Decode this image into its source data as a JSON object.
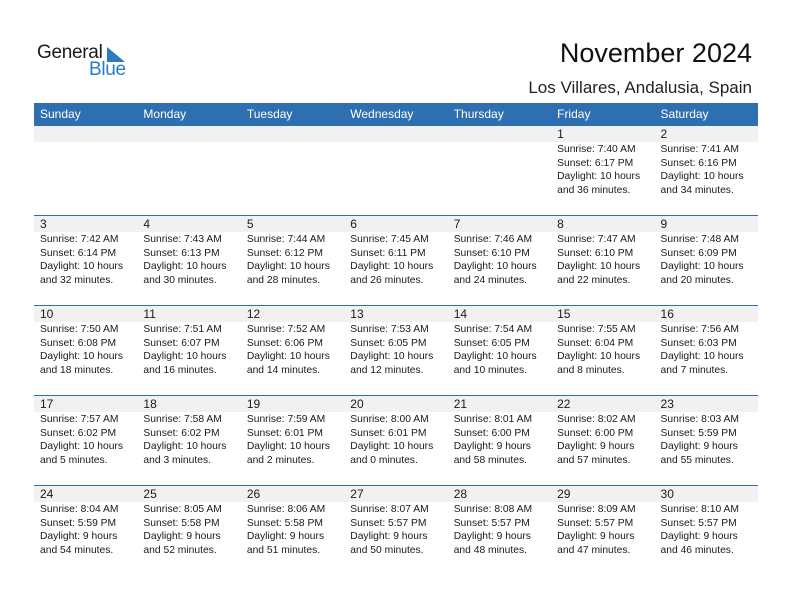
{
  "logo": {
    "general": "General",
    "blue": "Blue"
  },
  "title": "November 2024",
  "subtitle": "Los Villares, Andalusia, Spain",
  "colors": {
    "header_bg": "#2e6fb1",
    "daynum_bg": "#f1f1f1",
    "logo_blue": "#2a7bc4"
  },
  "weekdays": [
    "Sunday",
    "Monday",
    "Tuesday",
    "Wednesday",
    "Thursday",
    "Friday",
    "Saturday"
  ],
  "weeks": [
    [
      null,
      null,
      null,
      null,
      null,
      {
        "day": "1",
        "sunrise": "Sunrise: 7:40 AM",
        "sunset": "Sunset: 6:17 PM",
        "daylight1": "Daylight: 10 hours",
        "daylight2": "and 36 minutes."
      },
      {
        "day": "2",
        "sunrise": "Sunrise: 7:41 AM",
        "sunset": "Sunset: 6:16 PM",
        "daylight1": "Daylight: 10 hours",
        "daylight2": "and 34 minutes."
      }
    ],
    [
      {
        "day": "3",
        "sunrise": "Sunrise: 7:42 AM",
        "sunset": "Sunset: 6:14 PM",
        "daylight1": "Daylight: 10 hours",
        "daylight2": "and 32 minutes."
      },
      {
        "day": "4",
        "sunrise": "Sunrise: 7:43 AM",
        "sunset": "Sunset: 6:13 PM",
        "daylight1": "Daylight: 10 hours",
        "daylight2": "and 30 minutes."
      },
      {
        "day": "5",
        "sunrise": "Sunrise: 7:44 AM",
        "sunset": "Sunset: 6:12 PM",
        "daylight1": "Daylight: 10 hours",
        "daylight2": "and 28 minutes."
      },
      {
        "day": "6",
        "sunrise": "Sunrise: 7:45 AM",
        "sunset": "Sunset: 6:11 PM",
        "daylight1": "Daylight: 10 hours",
        "daylight2": "and 26 minutes."
      },
      {
        "day": "7",
        "sunrise": "Sunrise: 7:46 AM",
        "sunset": "Sunset: 6:10 PM",
        "daylight1": "Daylight: 10 hours",
        "daylight2": "and 24 minutes."
      },
      {
        "day": "8",
        "sunrise": "Sunrise: 7:47 AM",
        "sunset": "Sunset: 6:10 PM",
        "daylight1": "Daylight: 10 hours",
        "daylight2": "and 22 minutes."
      },
      {
        "day": "9",
        "sunrise": "Sunrise: 7:48 AM",
        "sunset": "Sunset: 6:09 PM",
        "daylight1": "Daylight: 10 hours",
        "daylight2": "and 20 minutes."
      }
    ],
    [
      {
        "day": "10",
        "sunrise": "Sunrise: 7:50 AM",
        "sunset": "Sunset: 6:08 PM",
        "daylight1": "Daylight: 10 hours",
        "daylight2": "and 18 minutes."
      },
      {
        "day": "11",
        "sunrise": "Sunrise: 7:51 AM",
        "sunset": "Sunset: 6:07 PM",
        "daylight1": "Daylight: 10 hours",
        "daylight2": "and 16 minutes."
      },
      {
        "day": "12",
        "sunrise": "Sunrise: 7:52 AM",
        "sunset": "Sunset: 6:06 PM",
        "daylight1": "Daylight: 10 hours",
        "daylight2": "and 14 minutes."
      },
      {
        "day": "13",
        "sunrise": "Sunrise: 7:53 AM",
        "sunset": "Sunset: 6:05 PM",
        "daylight1": "Daylight: 10 hours",
        "daylight2": "and 12 minutes."
      },
      {
        "day": "14",
        "sunrise": "Sunrise: 7:54 AM",
        "sunset": "Sunset: 6:05 PM",
        "daylight1": "Daylight: 10 hours",
        "daylight2": "and 10 minutes."
      },
      {
        "day": "15",
        "sunrise": "Sunrise: 7:55 AM",
        "sunset": "Sunset: 6:04 PM",
        "daylight1": "Daylight: 10 hours",
        "daylight2": "and 8 minutes."
      },
      {
        "day": "16",
        "sunrise": "Sunrise: 7:56 AM",
        "sunset": "Sunset: 6:03 PM",
        "daylight1": "Daylight: 10 hours",
        "daylight2": "and 7 minutes."
      }
    ],
    [
      {
        "day": "17",
        "sunrise": "Sunrise: 7:57 AM",
        "sunset": "Sunset: 6:02 PM",
        "daylight1": "Daylight: 10 hours",
        "daylight2": "and 5 minutes."
      },
      {
        "day": "18",
        "sunrise": "Sunrise: 7:58 AM",
        "sunset": "Sunset: 6:02 PM",
        "daylight1": "Daylight: 10 hours",
        "daylight2": "and 3 minutes."
      },
      {
        "day": "19",
        "sunrise": "Sunrise: 7:59 AM",
        "sunset": "Sunset: 6:01 PM",
        "daylight1": "Daylight: 10 hours",
        "daylight2": "and 2 minutes."
      },
      {
        "day": "20",
        "sunrise": "Sunrise: 8:00 AM",
        "sunset": "Sunset: 6:01 PM",
        "daylight1": "Daylight: 10 hours",
        "daylight2": "and 0 minutes."
      },
      {
        "day": "21",
        "sunrise": "Sunrise: 8:01 AM",
        "sunset": "Sunset: 6:00 PM",
        "daylight1": "Daylight: 9 hours",
        "daylight2": "and 58 minutes."
      },
      {
        "day": "22",
        "sunrise": "Sunrise: 8:02 AM",
        "sunset": "Sunset: 6:00 PM",
        "daylight1": "Daylight: 9 hours",
        "daylight2": "and 57 minutes."
      },
      {
        "day": "23",
        "sunrise": "Sunrise: 8:03 AM",
        "sunset": "Sunset: 5:59 PM",
        "daylight1": "Daylight: 9 hours",
        "daylight2": "and 55 minutes."
      }
    ],
    [
      {
        "day": "24",
        "sunrise": "Sunrise: 8:04 AM",
        "sunset": "Sunset: 5:59 PM",
        "daylight1": "Daylight: 9 hours",
        "daylight2": "and 54 minutes."
      },
      {
        "day": "25",
        "sunrise": "Sunrise: 8:05 AM",
        "sunset": "Sunset: 5:58 PM",
        "daylight1": "Daylight: 9 hours",
        "daylight2": "and 52 minutes."
      },
      {
        "day": "26",
        "sunrise": "Sunrise: 8:06 AM",
        "sunset": "Sunset: 5:58 PM",
        "daylight1": "Daylight: 9 hours",
        "daylight2": "and 51 minutes."
      },
      {
        "day": "27",
        "sunrise": "Sunrise: 8:07 AM",
        "sunset": "Sunset: 5:57 PM",
        "daylight1": "Daylight: 9 hours",
        "daylight2": "and 50 minutes."
      },
      {
        "day": "28",
        "sunrise": "Sunrise: 8:08 AM",
        "sunset": "Sunset: 5:57 PM",
        "daylight1": "Daylight: 9 hours",
        "daylight2": "and 48 minutes."
      },
      {
        "day": "29",
        "sunrise": "Sunrise: 8:09 AM",
        "sunset": "Sunset: 5:57 PM",
        "daylight1": "Daylight: 9 hours",
        "daylight2": "and 47 minutes."
      },
      {
        "day": "30",
        "sunrise": "Sunrise: 8:10 AM",
        "sunset": "Sunset: 5:57 PM",
        "daylight1": "Daylight: 9 hours",
        "daylight2": "and 46 minutes."
      }
    ]
  ]
}
